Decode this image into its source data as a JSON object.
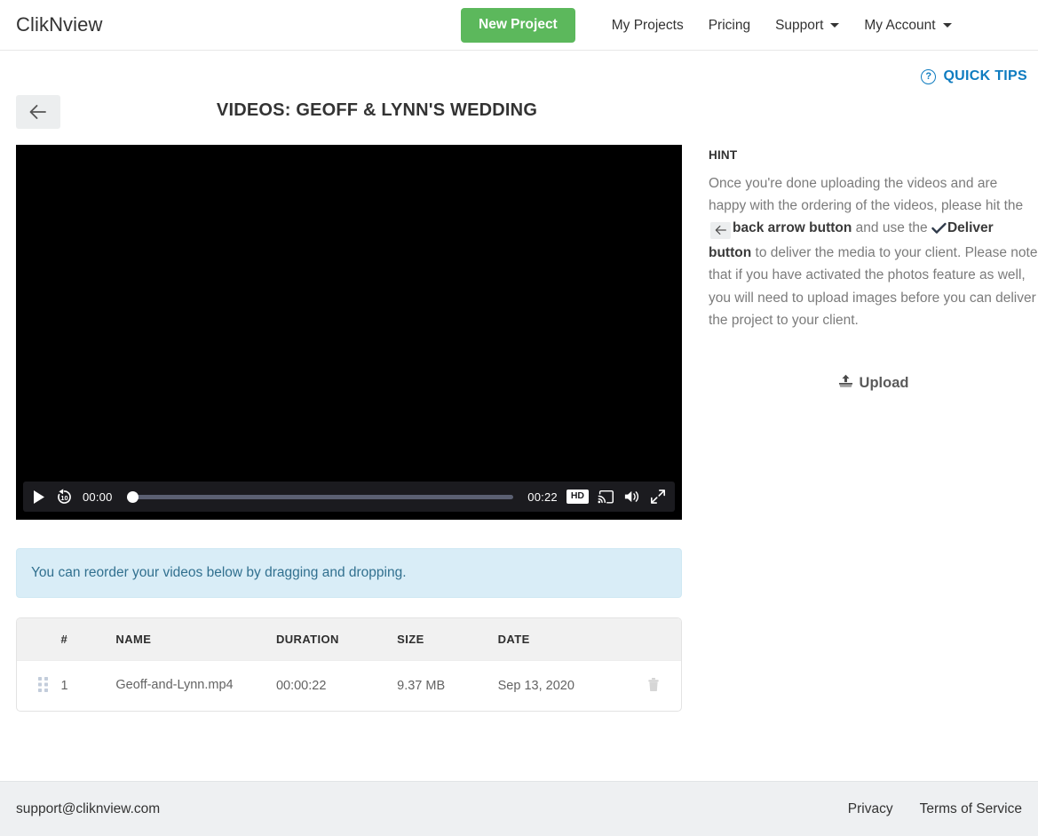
{
  "header": {
    "brand": "ClikNview",
    "new_project_label": "New Project",
    "nav": [
      {
        "label": "My Projects",
        "caret": false
      },
      {
        "label": "Pricing",
        "caret": false
      },
      {
        "label": "Support",
        "caret": true
      },
      {
        "label": "My Account",
        "caret": true
      }
    ]
  },
  "quick_tips": {
    "label": "QUICK TIPS",
    "icon": "question-circle-icon",
    "color": "#0f7cc0"
  },
  "title_bar": {
    "back_icon": "arrow-left-icon",
    "title": "VIDEOS: GEOFF & LYNN'S WEDDING"
  },
  "player": {
    "play_icon": "play-icon",
    "replay_icon": "replay-10-icon",
    "current_time": "00:00",
    "duration": "00:22",
    "hd_label": "HD",
    "cast_icon": "cast-icon",
    "volume_icon": "volume-high-icon",
    "fullscreen_icon": "fullscreen-icon",
    "progress_percent": 0
  },
  "hint": {
    "title": "HINT",
    "text_1": "Once you're done uploading the videos and are happy with the ordering of the videos, please hit the ",
    "bold_1": "back arrow button",
    "text_2": " and use the ",
    "bold_2": "Deliver button",
    "text_3": " to deliver the media to your client. Please note that if you have activated the photos feature as well, you will need to upload images before you can deliver the project to your client.",
    "upload_label": "Upload",
    "upload_icon": "upload-icon"
  },
  "alert": {
    "message": "You can reorder your videos below by dragging and dropping."
  },
  "table": {
    "columns": [
      "",
      "#",
      "NAME",
      "DURATION",
      "SIZE",
      "DATE",
      ""
    ],
    "rows": [
      {
        "handle_icon": "drag-handle-icon",
        "num": "1",
        "name": "Geoff-and-Lynn.mp4",
        "duration": "00:00:22",
        "size": "9.37 MB",
        "date": "Sep 13, 2020",
        "delete_icon": "trash-icon"
      }
    ]
  },
  "footer": {
    "email": "support@cliknview.com",
    "links": [
      {
        "label": "Privacy"
      },
      {
        "label": "Terms of Service"
      }
    ]
  },
  "colors": {
    "brand_green": "#5cb85c",
    "link_blue": "#0f7cc0",
    "alert_bg": "#d9edf7",
    "alert_text": "#31708f",
    "footer_bg": "#eef0f2"
  }
}
